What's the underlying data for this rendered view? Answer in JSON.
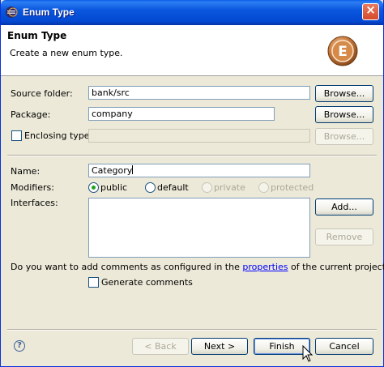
{
  "window": {
    "title": "Enum Type",
    "close_glyph": "×"
  },
  "header": {
    "title": "Enum Type",
    "description": "Create a new enum type.",
    "logo_letter": "E"
  },
  "form": {
    "source_folder": {
      "label": "Source folder:",
      "value": "bank/src",
      "button": "Browse..."
    },
    "package": {
      "label": "Package:",
      "value": "company",
      "button": "Browse..."
    },
    "enclosing_type": {
      "label": "Enclosing type:",
      "value": "",
      "button": "Browse...",
      "checked": false
    },
    "name": {
      "label": "Name:",
      "value": "Category"
    },
    "modifiers": {
      "label": "Modifiers:",
      "options": [
        {
          "label": "public",
          "selected": true,
          "enabled": true
        },
        {
          "label": "default",
          "selected": false,
          "enabled": true
        },
        {
          "label": "private",
          "selected": false,
          "enabled": false
        },
        {
          "label": "protected",
          "selected": false,
          "enabled": false
        }
      ]
    },
    "interfaces": {
      "label": "Interfaces:",
      "add_button": "Add...",
      "remove_button": "Remove"
    },
    "comments": {
      "prompt_before": "Do you want to add comments as configured in the ",
      "prompt_link": "properties",
      "prompt_after": " of the current project?",
      "checkbox_label": "Generate comments",
      "checked": false
    }
  },
  "footer": {
    "help_glyph": "?",
    "back": "< Back",
    "next": "Next >",
    "finish": "Finish",
    "cancel": "Cancel"
  },
  "colors": {
    "titlebar": "#0a57de",
    "dialog_bg": "#ece9d8",
    "button_border": "#003c74",
    "link": "#0000ff"
  }
}
